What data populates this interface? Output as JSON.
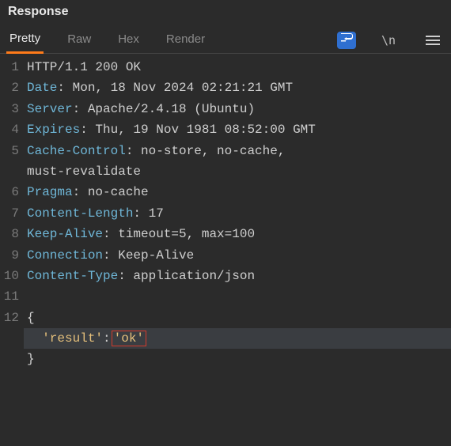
{
  "panel": {
    "title": "Response"
  },
  "tabs": {
    "pretty": "Pretty",
    "raw": "Raw",
    "hex": "Hex",
    "render": "Render"
  },
  "toolbar": {
    "wrap_badge": "⇋",
    "newline_label": "\\n",
    "menu_label": "≡"
  },
  "http": {
    "status_line": "HTTP/1.1 200 OK",
    "headers": [
      {
        "name": "Date",
        "value": "Mon, 18 Nov 2024 02:21:21 GMT"
      },
      {
        "name": "Server",
        "value": "Apache/2.4.18 (Ubuntu)"
      },
      {
        "name": "Expires",
        "value": "Thu, 19 Nov 1981 08:52:00 GMT"
      },
      {
        "name": "Cache-Control",
        "value": "no-store, no-cache, must-revalidate"
      },
      {
        "name": "Pragma",
        "value": "no-cache"
      },
      {
        "name": "Content-Length",
        "value": "17"
      },
      {
        "name": "Keep-Alive",
        "value": "timeout=5, max=100"
      },
      {
        "name": "Connection",
        "value": "Keep-Alive"
      },
      {
        "name": "Content-Type",
        "value": "application/json"
      }
    ],
    "body_open": "{",
    "body_key": "'result'",
    "body_colon": ":",
    "body_value": "'ok'",
    "body_close": "}"
  },
  "gutter": {
    "1": "1",
    "2": "2",
    "3": "3",
    "4": "4",
    "5": "5",
    "6": "6",
    "7": "7",
    "8": "8",
    "9": "9",
    "10": "10",
    "11": "11",
    "12": "12"
  }
}
